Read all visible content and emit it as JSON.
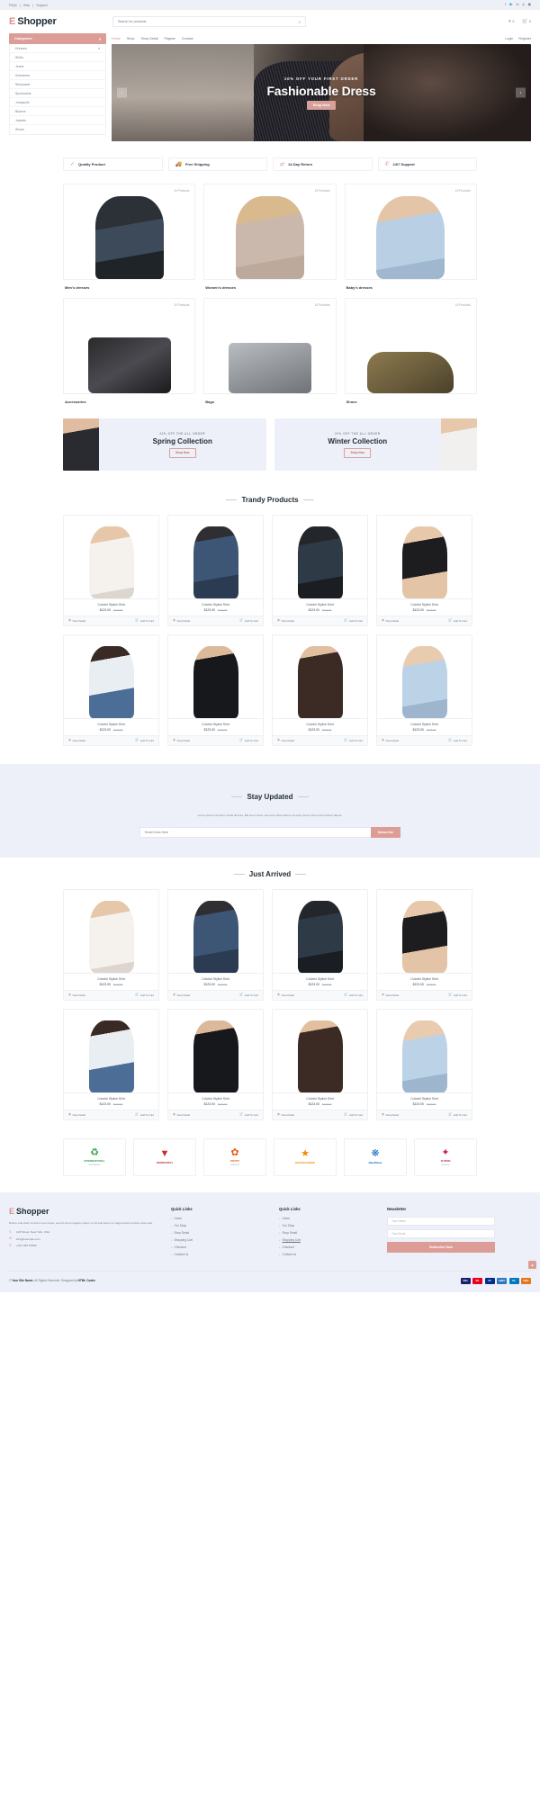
{
  "topbar": {
    "links": [
      "FAQs",
      "Help",
      "Support"
    ],
    "separator": "|",
    "social": [
      "facebook-icon",
      "twitter-icon",
      "linkedin-icon",
      "instagram-icon",
      "youtube-icon"
    ]
  },
  "header": {
    "logo_mark": "E",
    "logo_text": "Shopper",
    "search_placeholder": "Search for products",
    "wishlist_count": "0",
    "cart_count": "0"
  },
  "nav": {
    "items": [
      "Home",
      "Shop",
      "Shop Detail",
      "Pages",
      "Contact"
    ],
    "active": "Home",
    "pages_caret": "▾",
    "login": "Login",
    "register": "Register"
  },
  "categories": {
    "title": "Categories",
    "caret": "▾",
    "items": [
      {
        "label": "Dresses",
        "caret": "▾"
      },
      {
        "label": "Shirts",
        "caret": ""
      },
      {
        "label": "Jeans",
        "caret": ""
      },
      {
        "label": "Swimwear",
        "caret": ""
      },
      {
        "label": "Sleepwear",
        "caret": ""
      },
      {
        "label": "Sportswear",
        "caret": ""
      },
      {
        "label": "Jumpsuits",
        "caret": ""
      },
      {
        "label": "Blazers",
        "caret": ""
      },
      {
        "label": "Jackets",
        "caret": ""
      },
      {
        "label": "Shoes",
        "caret": ""
      }
    ]
  },
  "hero": {
    "kicker": "10% OFF YOUR FIRST ORDER",
    "title": "Fashionable Dress",
    "button": "Shop Now",
    "prev": "‹",
    "next": "›"
  },
  "features": [
    {
      "icon": "check-icon",
      "glyph": "✓",
      "label": "Quality Product"
    },
    {
      "icon": "truck-icon",
      "glyph": "🚚",
      "label": "Free Shipping"
    },
    {
      "icon": "exchange-icon",
      "glyph": "⇄",
      "label": "14-Day Return"
    },
    {
      "icon": "phone-icon",
      "glyph": "✆",
      "label": "24/7 Support"
    }
  ],
  "category_cards": [
    {
      "name": "Men's dresses",
      "count": "15 Products",
      "art": "ph-men"
    },
    {
      "name": "Women's dresses",
      "count": "15 Products",
      "art": "ph-women"
    },
    {
      "name": "Baby's dresses",
      "count": "15 Products",
      "art": "ph-baby"
    },
    {
      "name": "Accessories",
      "count": "15 Products",
      "art": "ph-acc"
    },
    {
      "name": "Bags",
      "count": "15 Products",
      "art": "ph-bag"
    },
    {
      "name": "Shoes",
      "count": "15 Products",
      "art": "ph-shoe"
    }
  ],
  "collections": [
    {
      "kicker": "20% OFF THE ALL ORDER",
      "title": "Spring Collection",
      "button": "Shop Now"
    },
    {
      "kicker": "20% OFF THE ALL ORDER",
      "title": "Winter Collection",
      "button": "Shop Now"
    }
  ],
  "trendy": {
    "title": "Trandy Products",
    "dash": "—"
  },
  "just_arrived": {
    "title": "Just Arrived",
    "dash": "—"
  },
  "product": {
    "name": "Colorful Stylish Shirt",
    "price": "$123.00",
    "old_price": "$123.00",
    "view_detail": "View Detail",
    "add_to_cart": "Add To Cart",
    "eye_glyph": "◉",
    "cart_glyph": "🛒"
  },
  "products_row_art": [
    "p-dress",
    "p-denim",
    "p-jacket",
    "p-tank",
    "p-girl",
    "p-suit",
    "p-coat",
    "p-boy"
  ],
  "newsletter_section": {
    "title": "Stay Updated",
    "dash": "—",
    "description": "Lorem ipsum sit dolum rimali dolores. Elit lorem dolor sed amet dolori labore sit justo ipsum eirmod duo labore labore.",
    "placeholder": "Email Goes Here",
    "button": "Subscribe"
  },
  "vendors": [
    {
      "glyph": "♻",
      "color": "#2f9e44",
      "name": "INTERNATIONAL",
      "sub": "INSURANCE"
    },
    {
      "glyph": "▼",
      "color": "#c92a2a",
      "name": "WORKAPPLY",
      "sub": ""
    },
    {
      "glyph": "✿",
      "color": "#e8590c",
      "name": "FRUITY",
      "sub": "PEBBLES"
    },
    {
      "glyph": "★",
      "color": "#f08c00",
      "name": "DATAXCHANGE",
      "sub": ""
    },
    {
      "glyph": "❋",
      "color": "#1971c2",
      "name": "BluePhlare",
      "sub": ""
    },
    {
      "glyph": "✦",
      "color": "#c2255c",
      "name": "FUZION",
      "sub": "SOURCE"
    }
  ],
  "footer": {
    "logo_mark": "E",
    "logo_text": "Shopper",
    "description": "Dolore erat dolor sit lorem vero amet, sed sit lorem magna, ipsum no sit erat lorem et magna ipsum dolore amet erat.",
    "contacts": [
      {
        "icon": "map-pin-icon",
        "glyph": "⚲",
        "text": "123 Street, New York, USA"
      },
      {
        "icon": "envelope-icon",
        "glyph": "✉",
        "text": "info@example.com"
      },
      {
        "icon": "phone-icon",
        "glyph": "✆",
        "text": "+012 345 67890"
      }
    ],
    "quick_links_1": {
      "title": "Quick Links",
      "items": [
        "Home",
        "Our Shop",
        "Shop Detail",
        "Shopping Cart",
        "Checkout",
        "Contact Us"
      ],
      "underlined": ""
    },
    "quick_links_2": {
      "title": "Quick Links",
      "items": [
        "Home",
        "Our Shop",
        "Shop Detail",
        "Shopping Cart",
        "Checkout",
        "Contact Us"
      ],
      "underlined": "Shopping Cart"
    },
    "newsletter": {
      "title": "Newsletter",
      "name_placeholder": "Your Name",
      "email_placeholder": "Your Email",
      "button": "Subscribe Now"
    },
    "copyright_pre": "© ",
    "copyright_site": "Your Site Name",
    "copyright_mid": ", All Rights Reserved. Designed by ",
    "copyright_by": "HTML Codex",
    "payments": [
      "VISA",
      "MC",
      "PP",
      "AMEX",
      "DC",
      "DISC"
    ],
    "to_top": "▲"
  }
}
